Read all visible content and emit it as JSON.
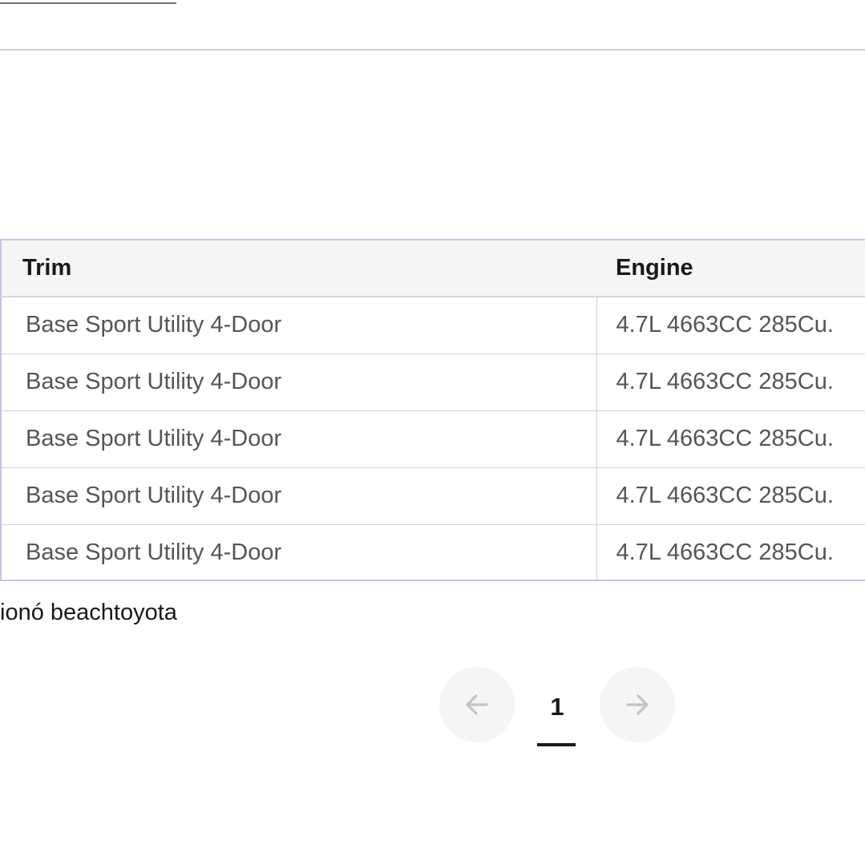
{
  "table": {
    "columns": [
      "Trim",
      "Engine"
    ],
    "rows": [
      {
        "trim": "Base Sport Utility 4-Door",
        "engine": "4.7L 4663CC 285Cu."
      },
      {
        "trim": "Base Sport Utility 4-Door",
        "engine": "4.7L 4663CC 285Cu."
      },
      {
        "trim": "Base Sport Utility 4-Door",
        "engine": "4.7L 4663CC 285Cu."
      },
      {
        "trim": "Base Sport Utility 4-Door",
        "engine": "4.7L 4663CC 285Cu."
      },
      {
        "trim": "Base Sport Utility 4-Door",
        "engine": "4.7L 4663CC 285Cu."
      }
    ]
  },
  "footnote": "ionó beachtoyota",
  "pagination": {
    "current_page": "1",
    "prev_icon": "arrow-left-icon",
    "next_icon": "arrow-right-icon"
  },
  "colors": {
    "table_border": "#c3c6e0",
    "header_bg": "#f5f5f5",
    "cell_text": "#555555",
    "pager_bg": "#f5f5f5"
  }
}
